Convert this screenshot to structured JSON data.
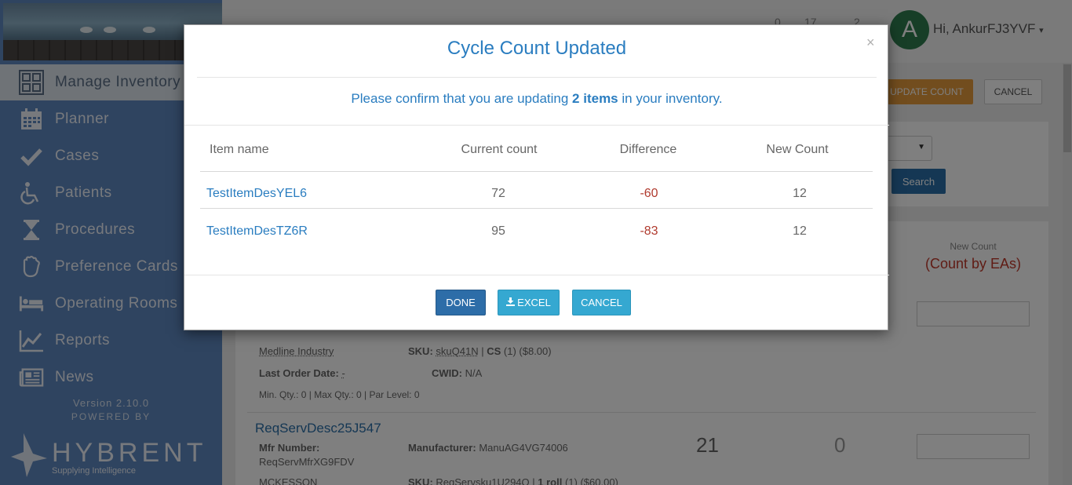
{
  "sidebar": {
    "active_item": {
      "label": "Manage Inventory",
      "icon": "inventory-grid-icon"
    },
    "items": [
      {
        "label": "Planner",
        "icon": "calendar-icon"
      },
      {
        "label": "Cases",
        "icon": "checkmark-icon"
      },
      {
        "label": "Patients",
        "icon": "wheelchair-icon"
      },
      {
        "label": "Procedures",
        "icon": "hourglass-icon"
      },
      {
        "label": "Preference Cards",
        "icon": "glove-icon"
      },
      {
        "label": "Operating Rooms",
        "icon": "bed-icon"
      },
      {
        "label": "Reports",
        "icon": "line-chart-icon"
      },
      {
        "label": "News",
        "icon": "newspaper-icon"
      }
    ],
    "version": "Version 2.10.0",
    "powered_by": "POWERED BY",
    "logo_text": "HYBRENT",
    "logo_tagline": "Supplying Intelligence"
  },
  "header": {
    "stats": [
      "0",
      "17",
      "2"
    ],
    "avatar_letter": "A",
    "greeting": "Hi, AnkurFJ3YVF"
  },
  "page": {
    "update_count_label": "UPDATE COUNT",
    "cancel_label": "CANCEL",
    "search_label": "Search",
    "new_count_header": "New Count",
    "count_by_header": "(Count by EAs)",
    "item1": {
      "manufacturer_line": "Medline Industry",
      "sku_label": "SKU:",
      "sku": "skuQ41N",
      "cs": "CS",
      "cs_detail": "(1) ($8.00)",
      "last_order_label": "Last Order Date:",
      "last_order": "-",
      "cwid_label": "CWID:",
      "cwid": "N/A",
      "qty_line": "Min. Qty.: 0 | Max Qty.: 0 | Par Level: 0"
    },
    "item2": {
      "title": "ReqServDesc25J547",
      "mfr_number_label": "Mfr Number:",
      "mfr_number": "ReqServMfrXG9FDV",
      "manufacturer_label": "Manufacturer:",
      "manufacturer": "ManuAG4VG74006",
      "current_count": "21",
      "difference": "0",
      "vendor": "MCKESSON",
      "sku_label": "SKU:",
      "sku": "ReqServsku1U294Q",
      "unit": "1 roll",
      "unit_detail": "(1) ($60.00)"
    }
  },
  "modal": {
    "title": "Cycle Count Updated",
    "close_glyph": "×",
    "message_prefix": "Please confirm that you are updating",
    "message_count": "2 items",
    "message_suffix": "in your inventory.",
    "columns": [
      "Item name",
      "Current count",
      "Difference",
      "New Count"
    ],
    "rows": [
      {
        "name": "TestItemDesYEL6",
        "current": "72",
        "difference": "-60",
        "new": "12"
      },
      {
        "name": "TestItemDesTZ6R",
        "current": "95",
        "difference": "-83",
        "new": "12"
      }
    ],
    "buttons": {
      "done": "DONE",
      "excel": "EXCEL",
      "cancel": "CANCEL"
    }
  },
  "colors": {
    "sidebar": "#5f88c0",
    "accent": "#2a7dc0",
    "negative": "#b03a2e",
    "done_button": "#2d6da8",
    "info_button": "#35a8d1"
  }
}
